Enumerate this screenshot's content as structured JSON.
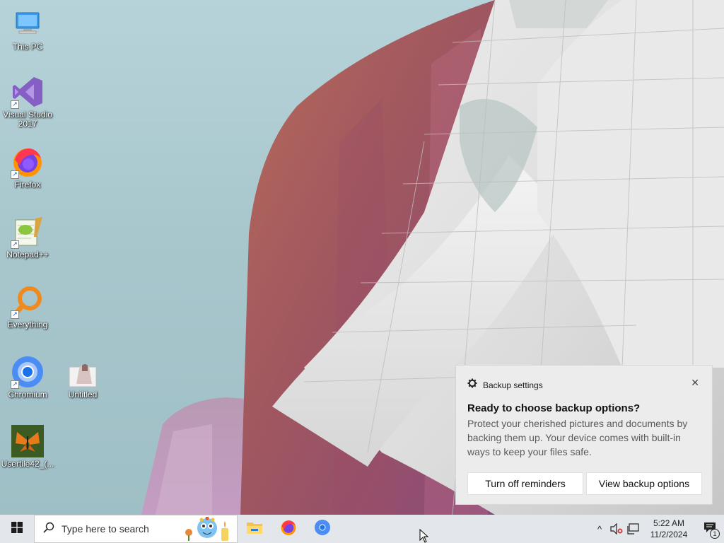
{
  "desktop": {
    "icons": [
      {
        "label": "This PC",
        "icon": "computer-icon"
      },
      {
        "label": "Visual Studio 2017",
        "icon": "visual-studio-icon"
      },
      {
        "label": "Firefox",
        "icon": "firefox-icon"
      },
      {
        "label": "Notepad++",
        "icon": "notepadpp-icon"
      },
      {
        "label": "Everything",
        "icon": "search-magnifier-icon"
      },
      {
        "label": "Chromium",
        "icon": "chromium-icon"
      },
      {
        "label": "Untitled",
        "icon": "image-file-icon"
      },
      {
        "label": "Usertile42_(...",
        "icon": "butterfly-image-icon"
      }
    ]
  },
  "toast": {
    "app_name": "Backup settings",
    "title": "Ready to choose backup options?",
    "body": "Protect your cherished pictures and documents by backing them up. Your device comes with built-in ways to keep your files safe.",
    "button_1": "Turn off reminders",
    "button_2": "View backup options",
    "close_glyph": "✕"
  },
  "taskbar": {
    "search_placeholder": "Type here to search",
    "apps": [
      "file-explorer-icon",
      "firefox-icon",
      "chromium-icon"
    ],
    "tray": {
      "chevron": "^",
      "time": "5:22 AM",
      "date": "11/2/2024",
      "notification_count": "1"
    }
  },
  "colors": {
    "taskbar_bg": "#e3e6ea",
    "toast_bg": "#ececec",
    "accent_blue": "#0078d7"
  }
}
